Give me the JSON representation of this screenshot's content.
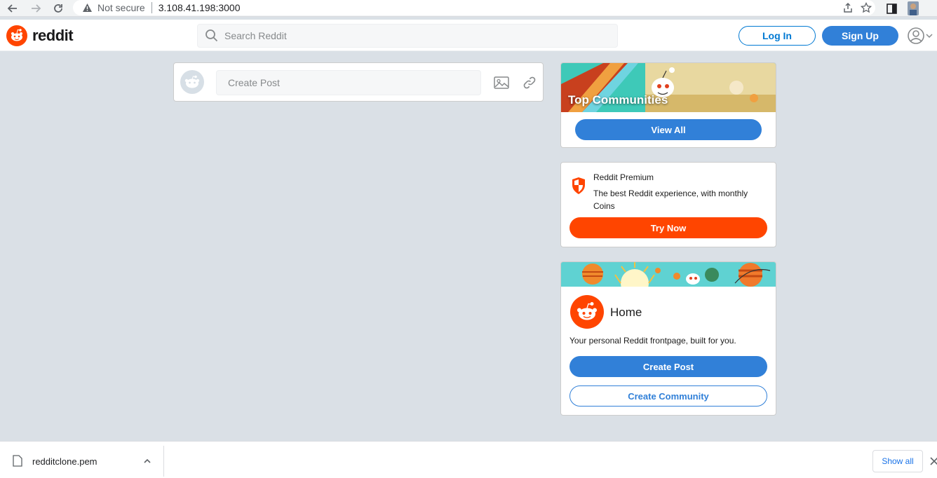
{
  "browser": {
    "security_label": "Not secure",
    "url": "3.108.41.198:3000"
  },
  "header": {
    "logo_text": "reddit",
    "search_placeholder": "Search Reddit",
    "login_label": "Log In",
    "signup_label": "Sign Up"
  },
  "create_post": {
    "placeholder": "Create Post"
  },
  "top_communities": {
    "title": "Top Communities",
    "button_label": "View All"
  },
  "premium": {
    "title": "Reddit Premium",
    "description": "The best Reddit experience, with monthly Coins",
    "button_label": "Try Now"
  },
  "home": {
    "title": "Home",
    "description": "Your personal Reddit frontpage, built for you.",
    "create_post_label": "Create Post",
    "create_community_label": "Create Community"
  },
  "download_bar": {
    "filename": "redditclone.pem",
    "show_all_label": "Show all"
  },
  "colors": {
    "reddit_orange": "#ff4500",
    "primary_blue": "#3180d8",
    "page_background": "#dae0e6"
  }
}
